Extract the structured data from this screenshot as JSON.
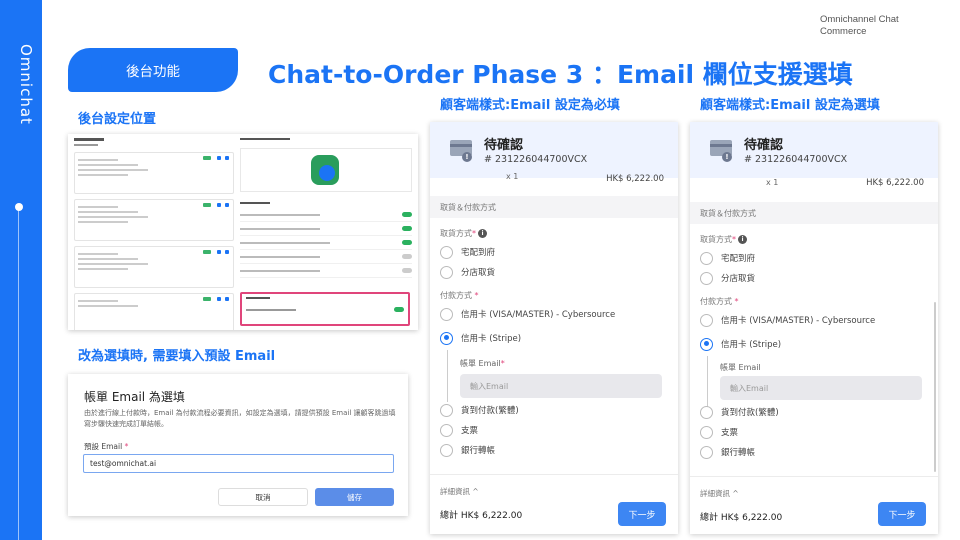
{
  "rail": {
    "logo": "Omnichat"
  },
  "brand": "Omnichannel Chat Commerce",
  "pill": "後台功能",
  "title": "Chat-to-Order Phase 3 ：Email 欄位支援選填",
  "sections": {
    "backend_location": "後台設定位置",
    "change_optional": "改為選填時, 需要填入預設 Email",
    "required_style": "顧客端樣式:Email 設定為必填",
    "optional_style": "顧客端樣式:Email 設定為選填"
  },
  "modal": {
    "title": "帳單 Email 為選填",
    "description": "由於進行線上付款時，Email 為付款流程必要資訊，如設定為選填，請提供預設 Email 讓顧客跳過填寫步驟快速完成訂單結帳。",
    "field_label": "預設 Email",
    "required_mark": "*",
    "field_value": "test@omnichat.ai",
    "cancel": "取消",
    "save": "儲存"
  },
  "phone_required": {
    "status": "待確認",
    "order_no": "# 231226044700VCX",
    "qty": "x 1",
    "price": "HK$ 6,222.00",
    "section": "取貨＆付款方式",
    "pickup_label": "取貨方式",
    "req": "*",
    "pickup_options": [
      "宅配到府",
      "分店取貨"
    ],
    "payment_label": "付款方式",
    "payment_options": [
      "信用卡 (VISA/MASTER) - Cybersource",
      "信用卡 (Stripe)"
    ],
    "email_label": "帳單 Email",
    "email_req": "*",
    "email_placeholder": "輸入Email",
    "more_options": [
      "貨到付款(繁體)",
      "支票",
      "銀行轉帳"
    ],
    "detail": "詳細資訊 ^",
    "total": "總計  HK$ 6,222.00",
    "next": "下一步"
  },
  "phone_optional": {
    "status": "待確認",
    "order_no": "# 231226044700VCX",
    "qty": "x 1",
    "price": "HK$  6,222.00",
    "section": "取貨＆付款方式",
    "pickup_label": "取貨方式",
    "req": "*",
    "pickup_options": [
      "宅配到府",
      "分店取貨"
    ],
    "payment_label": "付款方式",
    "payment_options": [
      "信用卡 (VISA/MASTER) - Cybersource",
      "信用卡 (Stripe)"
    ],
    "email_label": "帳單 Email",
    "email_placeholder": "輸入Email",
    "more_options": [
      "貨到付款(繁體)",
      "支票",
      "銀行轉帳"
    ],
    "detail": "詳細資訊 ^",
    "total": "總計  HK$ 6,222.00",
    "next": "下一步"
  },
  "colors": {
    "brand_blue": "#1b74f5",
    "highlight_pink": "#e0457b",
    "toggle_green": "#2bb15f"
  }
}
